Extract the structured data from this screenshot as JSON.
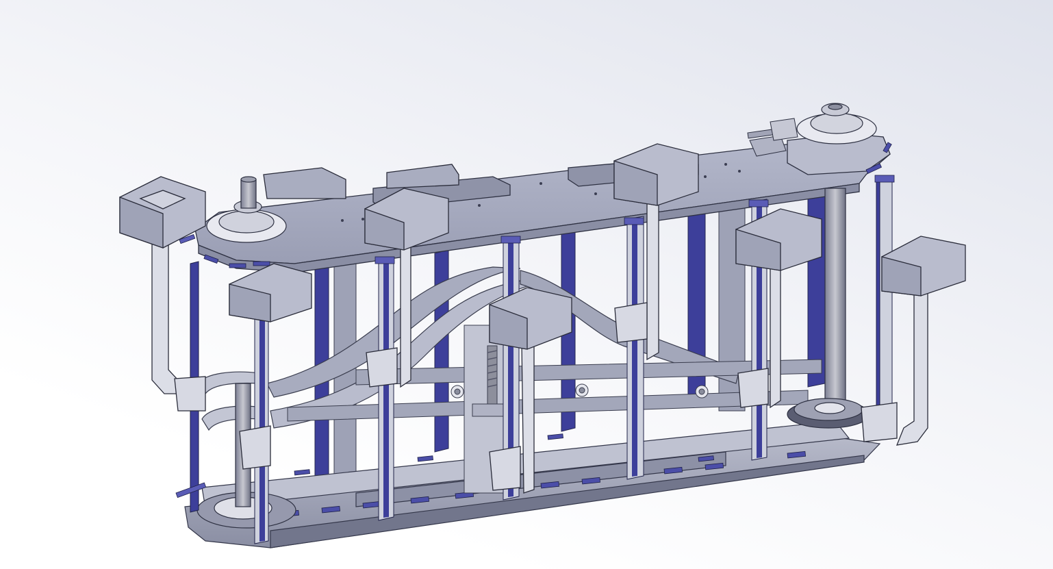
{
  "scene": {
    "kind": "cad-3d-viewport",
    "background": {
      "top": "#dfe2ec",
      "bottom": "#ffffff"
    },
    "colors": {
      "frame_light": "#c4c8d6",
      "frame_mid": "#a9adc0",
      "frame_dark": "#7b7f96",
      "rail_blue": "#3d3f9a",
      "rail_blue_light": "#7f82c8",
      "bearing": "#e6e7ee",
      "outline": "#2a2c3a"
    }
  }
}
